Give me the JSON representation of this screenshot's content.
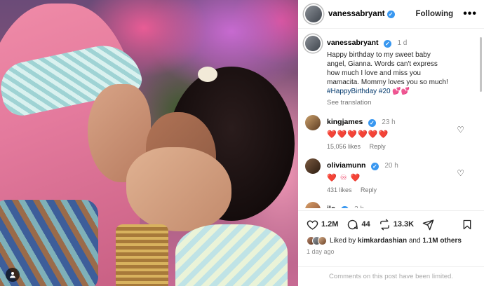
{
  "post": {
    "author": "vanessabryant",
    "follow_label": "Following",
    "more_label": "•••",
    "caption_time": "1 d",
    "caption": "Happy birthday to my sweet baby angel, Gianna. Words can't express how much I love and miss you mamacita. Mommy loves you so much!",
    "hashtags": "#HappyBirthday #20",
    "caption_emoji": "💕💕",
    "see_translation": "See translation"
  },
  "comments": [
    {
      "user": "kingjames",
      "time": "23 h",
      "text": "❤️❤️❤️❤️❤️❤️",
      "likes": "15,056 likes",
      "reply": "Reply"
    },
    {
      "user": "oliviamunn",
      "time": "20 h",
      "text": "❤️ ♾ ❤️",
      "likes": "431 likes",
      "reply": "Reply"
    },
    {
      "user": "jlo",
      "time": "2 h",
      "text": "❤️❤️"
    }
  ],
  "actions": {
    "likes_count": "1.2M",
    "comments_count": "44",
    "shares_count": "13.3K",
    "liked_by_prefix": "Liked by",
    "liked_by_user": "kimkardashian",
    "liked_by_and": "and",
    "liked_by_others": "1.1M others",
    "posted_ago": "1 day ago"
  },
  "footer": {
    "limited_text": "Comments on this post have been limited."
  },
  "icons": {
    "heart": "heart-icon",
    "comment": "comment-icon",
    "repost": "repost-icon",
    "share": "share-icon",
    "bookmark": "bookmark-icon",
    "verified": "verified-badge-icon",
    "people": "people-icon"
  },
  "colors": {
    "verified": "#3897f0",
    "hashtag": "#00376b",
    "muted": "#8e8e8e"
  }
}
